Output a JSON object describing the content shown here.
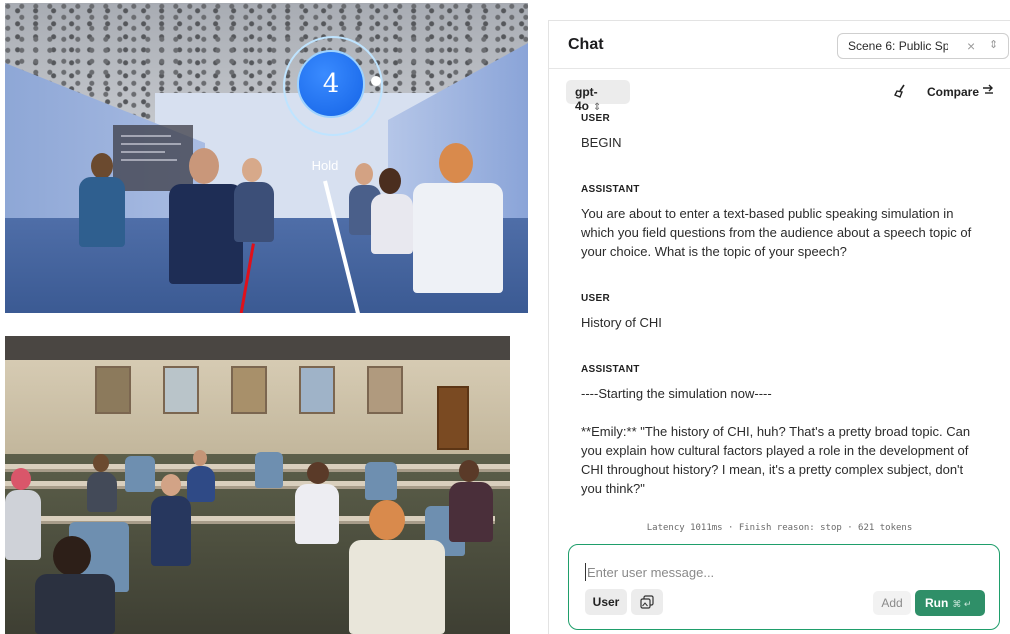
{
  "vr_scene": {
    "timer_value": "4",
    "hold_label": "Hold"
  },
  "chat": {
    "title": "Chat",
    "scene_select": {
      "value": "Scene 6: Public Sp..."
    },
    "model": "gpt-4o",
    "compare_label": "Compare",
    "messages": [
      {
        "role": "USER",
        "text": "BEGIN"
      },
      {
        "role": "ASSISTANT",
        "text": "You are about to enter a text-based public speaking simulation in which you field questions from the audience about a speech topic of your choice. What is the topic of your speech?"
      },
      {
        "role": "USER",
        "text": "History of CHI"
      },
      {
        "role": "ASSISTANT",
        "text": "----Starting the simulation now----",
        "text2": "**Emily:** \"The history of CHI, huh? That's a pretty broad topic. Can you explain how cultural factors played a role in the development of CHI throughout history? I mean, it's a pretty complex subject, don't you think?\""
      }
    ],
    "meta": "Latency 1011ms · Finish reason: stop · 621 tokens",
    "composer": {
      "placeholder": "Enter user message...",
      "role_button": "User",
      "add_button": "Add",
      "run_button": "Run",
      "run_shortcut": "⌘ ↵"
    }
  }
}
